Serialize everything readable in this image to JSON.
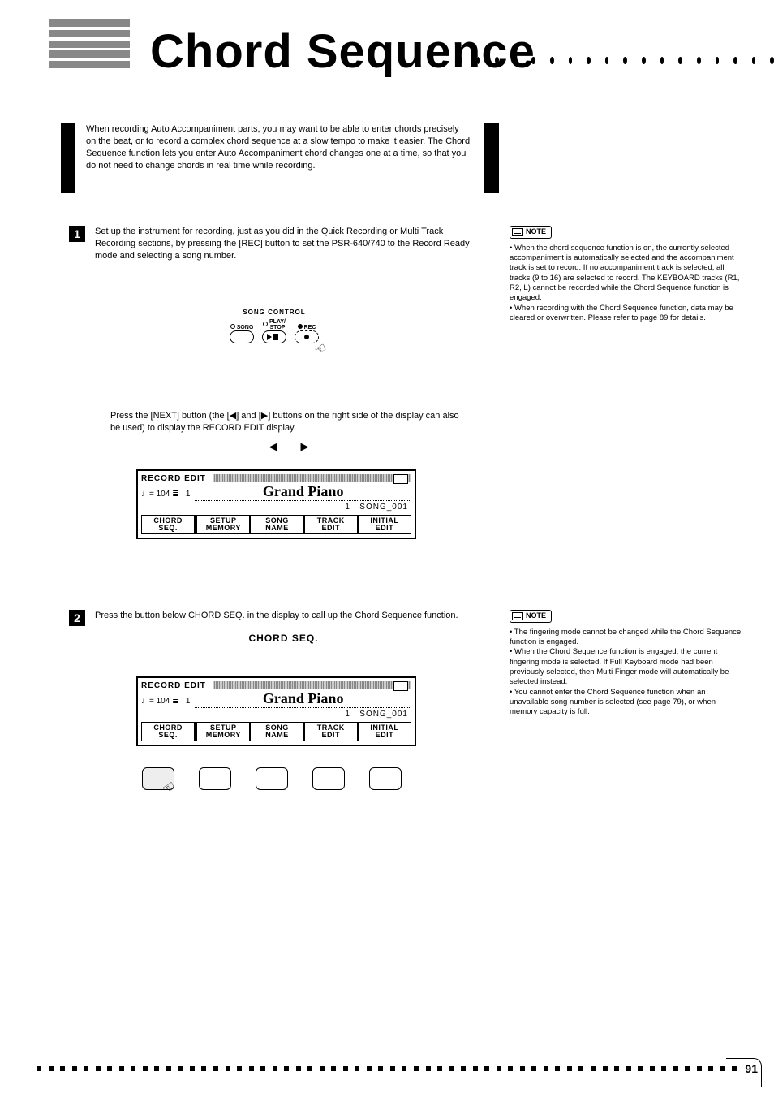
{
  "title": "Chord Sequence",
  "intro": "When recording Auto Accompaniment parts, you may want to be able to enter chords precisely on the beat, or to record a complex chord sequence at a slow tempo to make it easier. The Chord Sequence function lets you enter Auto Accompaniment chord changes one at a time, so that you do not need to change chords in real time while recording.",
  "steps": {
    "s1": {
      "num": "1",
      "text": "Set up the instrument for recording, just as you did in the Quick Recording or Multi Track Recording sections, by pressing the [REC] button to set the PSR-640/740 to the Record Ready mode and selecting a song number.",
      "extra": "Press the [NEXT] button (the [◀] and [▶] buttons on the right side of the display can also be used) to display the RECORD EDIT display."
    },
    "s2": {
      "num": "2",
      "text": "Press the button below CHORD SEQ. in the display to call up the Chord Sequence function."
    }
  },
  "chord_seq_label": "CHORD SEQ.",
  "song_control": {
    "title": "SONG CONTROL",
    "song": "SONG",
    "playstop1": "PLAY/",
    "playstop2": "STOP",
    "rec": "REC"
  },
  "arrows": {
    "left": "◀",
    "right": "▶"
  },
  "lcd": {
    "header": "RECORD EDIT",
    "met": "♩= 104",
    "bar_icon": "≣",
    "bar_num": "1",
    "voice": "Grand Piano",
    "song_no": "1",
    "song_name": "SONG_001",
    "tabs": [
      "CHORD\nSEQ.",
      "SETUP\nMEMORY",
      "SONG\nNAME",
      "TRACK\nEDIT",
      "INITIAL\nEDIT"
    ]
  },
  "notes": {
    "label": "NOTE",
    "n1": "• When the chord sequence function is on, the currently selected accompaniment is automatically selected and the accompaniment track is set to record. If no accompaniment track is selected, all tracks (9 to 16) are selected to record. The KEYBOARD tracks (R1, R2, L) cannot be recorded while the Chord Sequence function is engaged.\n• When recording with the Chord Sequence function, data may be cleared or overwritten. Please refer to page 89 for details.",
    "n2": "• The fingering mode cannot be changed while the Chord Sequence function is engaged.\n• When the Chord Sequence function is engaged, the current fingering mode is selected. If Full Keyboard mode had been previously selected, then Multi Finger mode will automatically be selected instead.\n• You cannot enter the Chord Sequence function when an unavailable song number is selected (see page 79), or when memory capacity is full."
  },
  "page_number": "91"
}
